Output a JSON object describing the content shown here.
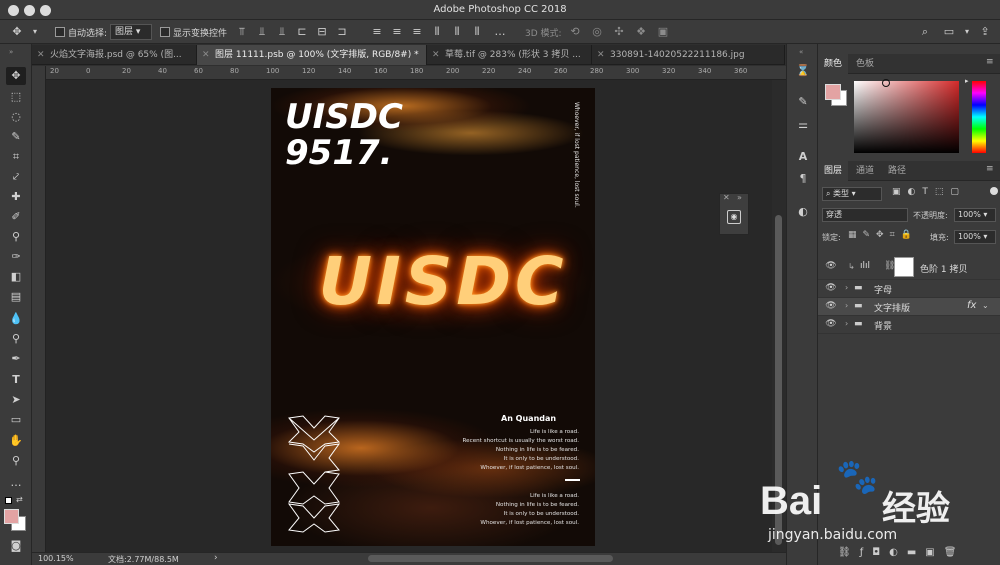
{
  "window": {
    "title": "Adobe Photoshop CC 2018"
  },
  "options_bar": {
    "auto_select_label": "自动选择:",
    "auto_select_value": "图层",
    "show_transform_label": "显示变换控件",
    "mode_3d_label": "3D 模式:"
  },
  "tabs": [
    {
      "label": "火焰文字海报.psd @ 65% (图..."
    },
    {
      "label": "图层 11111.psb @ 100% (文字排版, RGB/8#) *"
    },
    {
      "label": "草莓.tif @ 283% (形状 3 拷贝 ..."
    },
    {
      "label": "330891-14020522211186.jpg"
    }
  ],
  "rulers": {
    "top": [
      "20",
      "0",
      "20",
      "40",
      "60",
      "80",
      "100",
      "120",
      "140",
      "160",
      "180",
      "200",
      "220",
      "240",
      "260",
      "280",
      "300",
      "320",
      "340",
      "360"
    ]
  },
  "document": {
    "title_line1": "UISDC",
    "title_line2": "9517.",
    "side_text": "Whoever, if lost patience, lost soul.",
    "fire_text": "UISDC",
    "author": "An Quandan",
    "block1": [
      "Life is like a road.",
      "Recent shortcut is usually the worst road.",
      "Nothing in life is to be feared.",
      "It is only to be understood.",
      "Whoever, if lost patience, lost soul."
    ],
    "block2": [
      "Life is like a road.",
      "Nothing in life is to be feared.",
      "It is only to be understood.",
      "Whoever, if lost patience, lost soul."
    ]
  },
  "panels": {
    "color_tabs": [
      "颜色",
      "色板"
    ],
    "layer_tabs": [
      "图层",
      "通道",
      "路径"
    ],
    "filter_kind": "类型",
    "blend_mode": "穿透",
    "opacity_label": "不透明度:",
    "opacity_value": "100%",
    "lock_label": "锁定:",
    "fill_label": "填充:",
    "fill_value": "100%",
    "layers": [
      {
        "name": "色阶 1 拷贝",
        "type": "adjustment"
      },
      {
        "name": "字母",
        "type": "group"
      },
      {
        "name": "文字排版",
        "type": "group",
        "fx": "fx"
      },
      {
        "name": "背景",
        "type": "group"
      }
    ]
  },
  "status": {
    "zoom": "100.15%",
    "doc_size": "文档:2.77M/88.5M"
  },
  "watermark": {
    "brand": "Bai",
    "brand2": "经验",
    "url": "jingyan.baidu.com"
  },
  "colors": {
    "foreground": "#e3a3a3",
    "background": "#ffffff",
    "fire": "#ff9a2a"
  }
}
